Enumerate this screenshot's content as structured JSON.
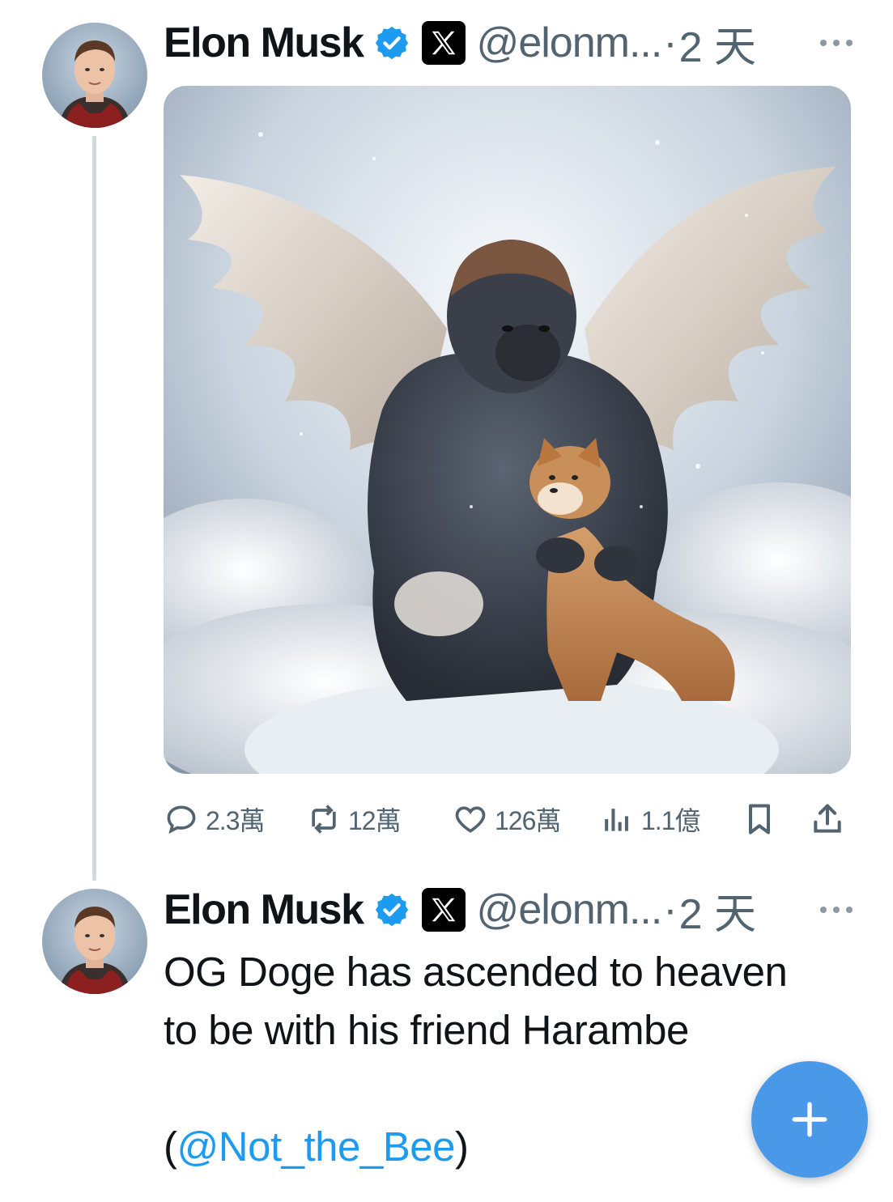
{
  "tweets": [
    {
      "author": "Elon Musk",
      "handle": "@elonm...",
      "separator": "·",
      "time": "2 天",
      "stats": {
        "replies": "2.3萬",
        "retweets": "12萬",
        "likes": "126萬",
        "views": "1.1億"
      }
    },
    {
      "author": "Elon Musk",
      "handle": "@elonm...",
      "separator": "·",
      "time": "2 天",
      "text_line1": "OG Doge has ascended to heaven",
      "text_line2": "to be with his friend Harambe",
      "paren_open": "(",
      "mention": "@Not_the_Bee",
      "paren_close": ")"
    }
  ],
  "icons": {
    "verified": "verified-badge-icon",
    "x_logo": "x-logo-icon",
    "more": "more-icon",
    "reply": "reply-icon",
    "retweet": "retweet-icon",
    "like": "heart-icon",
    "views": "views-icon",
    "bookmark": "bookmark-icon",
    "share": "share-icon",
    "compose": "plus-icon"
  },
  "colors": {
    "accent": "#1d9bf0",
    "verified": "#1d9bf0",
    "secondary_text": "#536471",
    "fab": "#4a99e9"
  }
}
